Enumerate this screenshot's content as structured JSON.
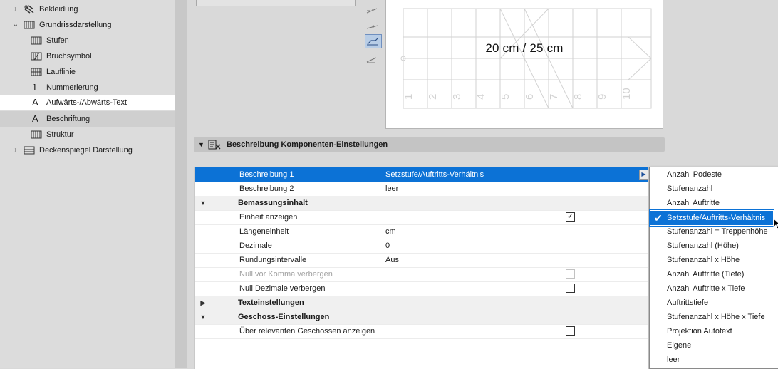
{
  "tree": {
    "items": [
      {
        "label": "Bekleidung",
        "icon": "cladding-icon",
        "expander": "collapsed"
      },
      {
        "label": "Grundrissdarstellung",
        "icon": "floorplan-icon",
        "expander": "expanded"
      },
      {
        "label": "Stufen",
        "icon": "treads-icon"
      },
      {
        "label": "Bruchsymbol",
        "icon": "break-mark-icon"
      },
      {
        "label": "Lauflinie",
        "icon": "walking-line-icon"
      },
      {
        "label": "Nummerierung",
        "icon": "numbering-icon",
        "glyph": "1"
      },
      {
        "label": "Aufwärts-/Abwärts-Text",
        "icon": "up-down-text-icon",
        "glyph": "A"
      },
      {
        "label": "Beschriftung",
        "icon": "label-icon",
        "glyph": "A"
      },
      {
        "label": "Struktur",
        "icon": "structure-icon"
      },
      {
        "label": "Deckenspiegel Darstellung",
        "icon": "ceiling-plan-icon",
        "expander": "collapsed"
      }
    ]
  },
  "preview": {
    "label_text": "20 cm / 25 cm",
    "stair_numbers": [
      "1",
      "2",
      "3",
      "4",
      "5",
      "6",
      "7",
      "8",
      "9",
      "10"
    ]
  },
  "section": {
    "title": "Beschreibung Komponenten-Einstellungen"
  },
  "properties": {
    "rows": [
      {
        "name": "Beschreibung 1",
        "value": "Setzstufe/Auftritts-Verhältnis"
      },
      {
        "name": "Beschreibung 2",
        "value": "leer"
      },
      {
        "group": "Bemassungsinhalt"
      },
      {
        "name": "Einheit anzeigen",
        "checked": true
      },
      {
        "name": "Längeneinheit",
        "value": "cm"
      },
      {
        "name": "Dezimale",
        "value": "0"
      },
      {
        "name": "Rundungsintervalle",
        "value": "Aus"
      },
      {
        "name": "Null vor Komma verbergen",
        "checked": false,
        "disabled": true
      },
      {
        "name": "Null Dezimale verbergen",
        "checked": false
      },
      {
        "group": "Texteinstellungen"
      },
      {
        "group": "Geschoss-Einstellungen"
      },
      {
        "name": "Über relevanten Geschossen anzeigen",
        "checked": false
      }
    ]
  },
  "dropdown": {
    "selected": "Setzstufe/Auftritts-Verhältnis",
    "options": [
      "Anzahl Podeste",
      "Stufenanzahl",
      "Anzahl Auftritte",
      "Setzstufe/Auftritts-Verhältnis",
      "Stufenanzahl = Treppenhöhe",
      "Stufenanzahl (Höhe)",
      "Stufenanzahl x Höhe",
      "Anzahl Auftritte (Tiefe)",
      "Anzahl Auftritte x Tiefe",
      "Auftrittstiefe",
      "Stufenanzahl x Höhe x Tiefe",
      "Projektion Autotext",
      "Eigene",
      "leer"
    ]
  },
  "colors": {
    "highlight": "#0c72d6",
    "panel": "#d9d9d9",
    "tree_selected": "#cfcfcf"
  }
}
